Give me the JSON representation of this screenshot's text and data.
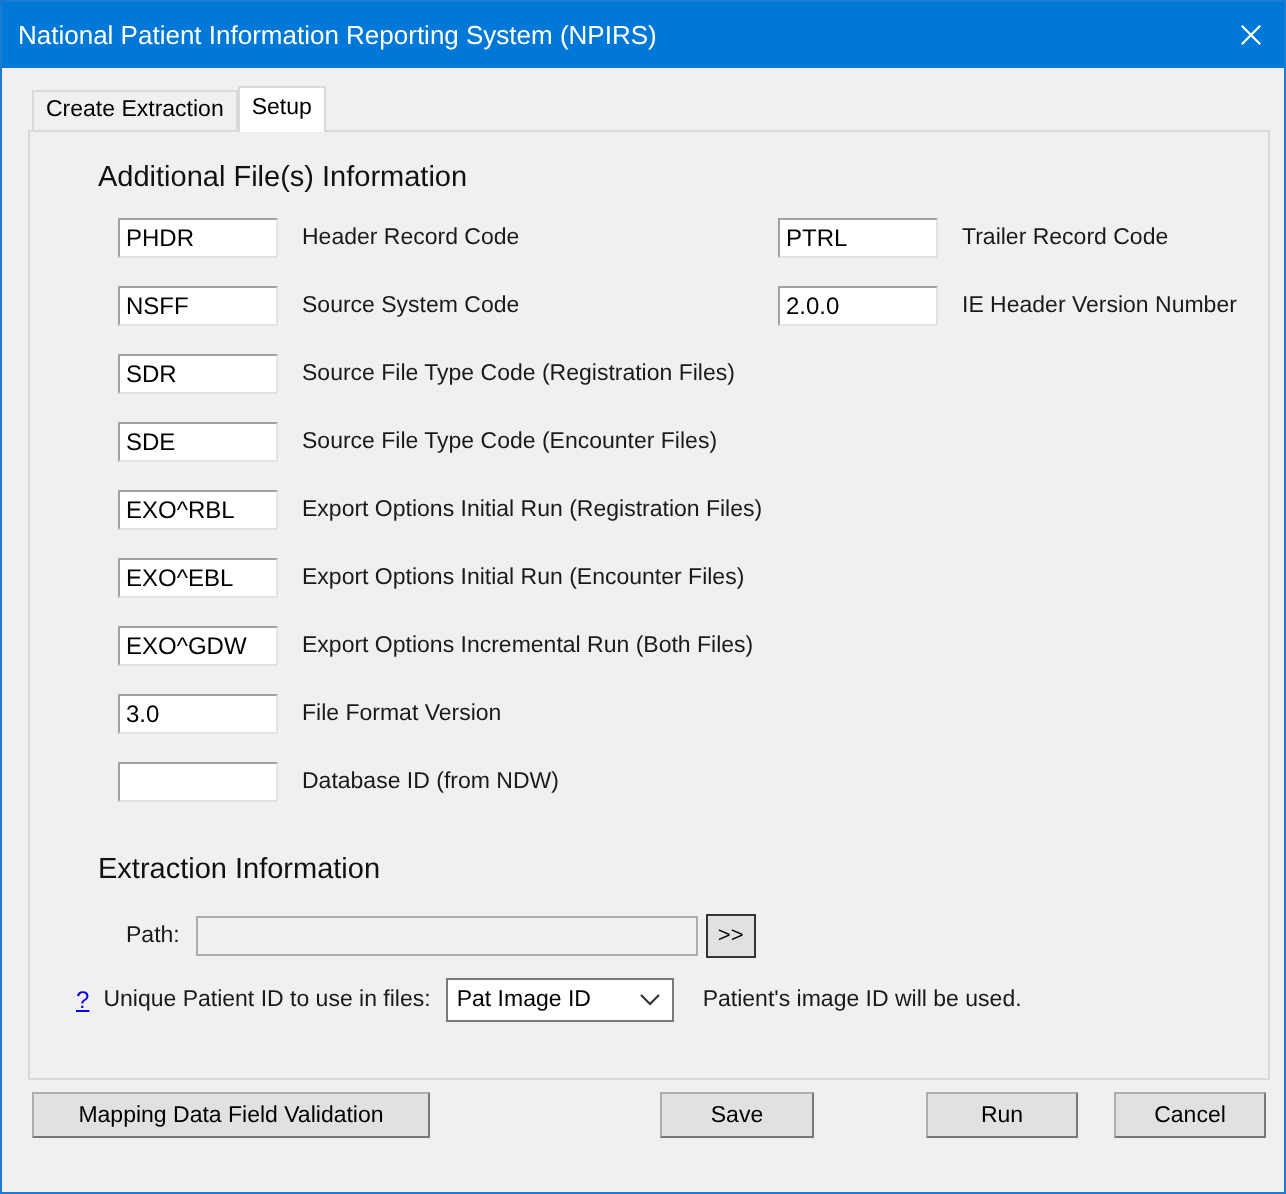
{
  "window": {
    "title": "National Patient Information Reporting System (NPIRS)"
  },
  "tabs": [
    {
      "label": "Create Extraction",
      "selected": false
    },
    {
      "label": "Setup",
      "selected": true
    }
  ],
  "additional_info": {
    "heading": "Additional File(s) Information",
    "rows": [
      {
        "left": {
          "value": "PHDR",
          "label": "Header Record Code"
        },
        "right": {
          "value": "PTRL",
          "label": "Trailer Record Code"
        }
      },
      {
        "left": {
          "value": "NSFF",
          "label": "Source System Code"
        },
        "right": {
          "value": "2.0.0",
          "label": "IE Header Version Number"
        }
      },
      {
        "left": {
          "value": "SDR",
          "label": "Source File Type Code (Registration Files)"
        }
      },
      {
        "left": {
          "value": "SDE",
          "label": "Source File Type Code (Encounter Files)"
        }
      },
      {
        "left": {
          "value": "EXO^RBL",
          "label": "Export Options Initial Run (Registration Files)"
        }
      },
      {
        "left": {
          "value": "EXO^EBL",
          "label": "Export Options Initial Run (Encounter Files)"
        }
      },
      {
        "left": {
          "value": "EXO^GDW",
          "label": "Export Options Incremental Run (Both Files)"
        }
      },
      {
        "left": {
          "value": "3.0",
          "label": "File Format Version"
        }
      },
      {
        "left": {
          "label": "Database ID (from NDW)"
        }
      }
    ]
  },
  "extraction_info": {
    "heading": "Extraction Information",
    "path": {
      "label": "Path:",
      "disabled": true,
      "browse_button": ">>"
    },
    "patient_id": {
      "help_link": "?",
      "label": "Unique Patient ID to use in files:",
      "selection": "Pat Image ID",
      "note": "Patient's image ID will be used."
    }
  },
  "buttons": [
    "Mapping Data Field Validation",
    "Save",
    "Run",
    "Cancel"
  ]
}
